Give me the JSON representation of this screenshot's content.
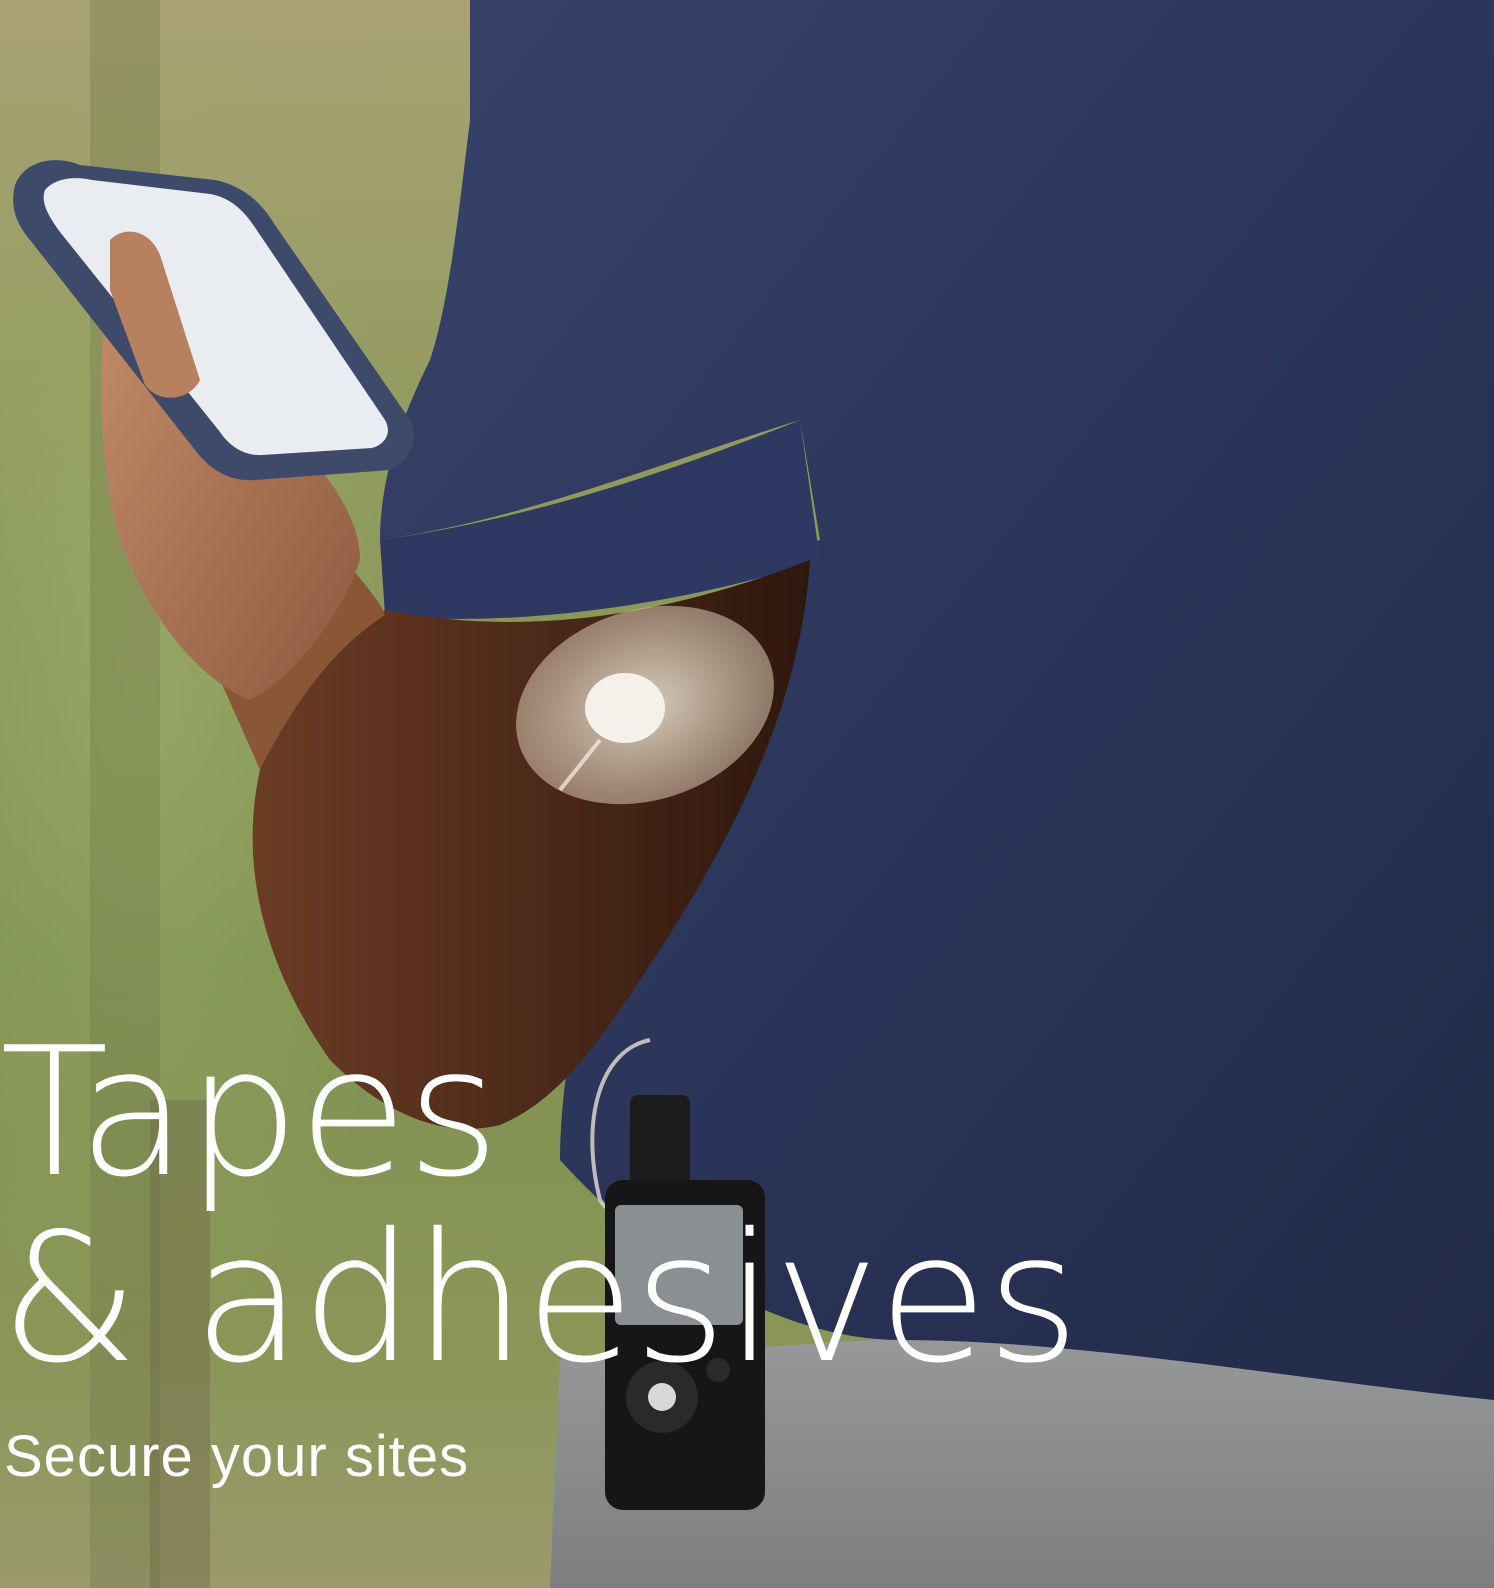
{
  "headline": {
    "line1": "Tapes",
    "line2": "& adhesives"
  },
  "subheadline": "Secure your sites",
  "colors": {
    "background_green": "#8f9a5c",
    "shirt_navy": "#2b3456",
    "skin": "#5a3320",
    "shorts_gray": "#8a8c8e",
    "text": "#ffffff"
  }
}
